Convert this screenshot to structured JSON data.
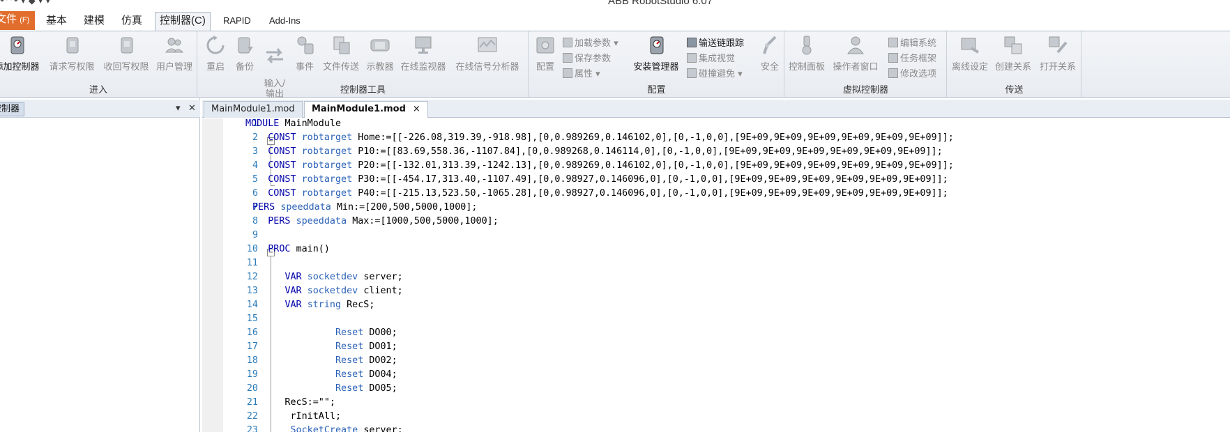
{
  "window": {
    "title": "ABB RobotStudio 6.07",
    "qat_glyphs": "↶ ↷ ▾ ◆ ▾ ▾"
  },
  "ribbon_tabs": [
    {
      "label": "文件",
      "accel": "(F)"
    },
    {
      "label": "基本"
    },
    {
      "label": "建模"
    },
    {
      "label": "仿真"
    },
    {
      "label": "控制器(C)"
    },
    {
      "label": "RAPID"
    },
    {
      "label": "Add-Ins"
    }
  ],
  "groups": {
    "enter": {
      "label": "进入",
      "buttons": [
        "添加控制器",
        "请求写权限",
        "收回写权限",
        "用户管理"
      ]
    },
    "tools": {
      "label": "控制器工具",
      "buttons": [
        "重启",
        "备份",
        "输入/\n输出",
        "事件",
        "文件传送",
        "示教器",
        "在线监视器",
        "在线信号分析器"
      ]
    },
    "config": {
      "label": "配置",
      "big1": "配置",
      "small": [
        "加载参数 ▾",
        "保存参数",
        "属性 ▾"
      ],
      "big2": "安装管理器",
      "small2": [
        "输送链跟踪",
        "集成视觉",
        "碰撞避免 ▾"
      ],
      "big3": "安全"
    },
    "virtual": {
      "label": "虚拟控制器",
      "buttons": [
        "控制面板",
        "操作者窗口"
      ],
      "small": [
        "编辑系统",
        "任务框架",
        "修改选项"
      ]
    },
    "transfer": {
      "label": "传送",
      "buttons": [
        "离线设定",
        "创建关系",
        "打开关系"
      ]
    }
  },
  "left_panel": {
    "tab_label": "控制器",
    "pin": "▾",
    "close": "✕"
  },
  "doc_tabs": [
    {
      "label": "MainModule1.mod"
    },
    {
      "label": "MainModule1.mod",
      "close": "×"
    }
  ],
  "code_lines": [
    {
      "n": "1",
      "parts": [
        [
          "kw",
          "MODULE"
        ],
        [
          "",
          "MainModule"
        ]
      ]
    },
    {
      "n": "2",
      "parts": [
        [
          "",
          "    "
        ],
        [
          "kw",
          "CONST"
        ],
        [
          "",
          ""
        ],
        [
          "ty",
          "robtarget"
        ],
        [
          "",
          "Home:=[[-226.08,319.39,-918.98],[0,0.989269,0.146102,0],[0,-1,0,0],[9E+09,9E+09,9E+09,9E+09,9E+09,9E+09]];"
        ]
      ]
    },
    {
      "n": "3",
      "parts": [
        [
          "",
          "    "
        ],
        [
          "kw",
          "CONST"
        ],
        [
          "",
          ""
        ],
        [
          "ty",
          "robtarget"
        ],
        [
          "",
          "P10:=[[83.69,558.36,-1107.84],[0,0.989268,0.146114,0],[0,-1,0,0],[9E+09,9E+09,9E+09,9E+09,9E+09,9E+09]];"
        ]
      ]
    },
    {
      "n": "4",
      "parts": [
        [
          "",
          "    "
        ],
        [
          "kw",
          "CONST"
        ],
        [
          "",
          ""
        ],
        [
          "ty",
          "robtarget"
        ],
        [
          "",
          "P20:=[[-132.01,313.39,-1242.13],[0,0.989269,0.146102,0],[0,-1,0,0],[9E+09,9E+09,9E+09,9E+09,9E+09,9E+09]];"
        ]
      ]
    },
    {
      "n": "5",
      "parts": [
        [
          "",
          "    "
        ],
        [
          "kw",
          "CONST"
        ],
        [
          "",
          ""
        ],
        [
          "ty",
          "robtarget"
        ],
        [
          "",
          "P30:=[[-454.17,313.40,-1107.49],[0,0.98927,0.146096,0],[0,-1,0,0],[9E+09,9E+09,9E+09,9E+09,9E+09,9E+09]];"
        ]
      ]
    },
    {
      "n": "6",
      "parts": [
        [
          "",
          "    "
        ],
        [
          "kw",
          "CONST"
        ],
        [
          "",
          ""
        ],
        [
          "ty",
          "robtarget"
        ],
        [
          "",
          "P40:=[[-215.13,523.50,-1065.28],[0,0.98927,0.146096,0],[0,-1,0,0],[9E+09,9E+09,9E+09,9E+09,9E+09,9E+09]];"
        ]
      ]
    },
    {
      "n": "7",
      "parts": [
        [
          "kw",
          "PERS"
        ],
        [
          "",
          ""
        ],
        [
          "ty",
          "speeddata"
        ],
        [
          "",
          "Min:=[200,500,5000,1000];"
        ]
      ]
    },
    {
      "n": "8",
      "parts": [
        [
          "",
          "    "
        ],
        [
          "kw",
          "PERS"
        ],
        [
          "",
          ""
        ],
        [
          "ty",
          "speeddata"
        ],
        [
          "",
          "Max:=[1000,500,5000,1000];"
        ]
      ]
    },
    {
      "n": "9",
      "parts": []
    },
    {
      "n": "10",
      "parts": [
        [
          "",
          "    "
        ],
        [
          "kw",
          "PROC"
        ],
        [
          "",
          "main()"
        ]
      ]
    },
    {
      "n": "11",
      "parts": []
    },
    {
      "n": "12",
      "parts": [
        [
          "",
          "       "
        ],
        [
          "kw",
          "VAR"
        ],
        [
          "",
          ""
        ],
        [
          "ty",
          "socketdev"
        ],
        [
          "",
          "server;"
        ]
      ]
    },
    {
      "n": "13",
      "parts": [
        [
          "",
          "       "
        ],
        [
          "kw",
          "VAR"
        ],
        [
          "",
          ""
        ],
        [
          "ty",
          "socketdev"
        ],
        [
          "",
          "client;"
        ]
      ]
    },
    {
      "n": "14",
      "parts": [
        [
          "",
          "       "
        ],
        [
          "kw",
          "VAR"
        ],
        [
          "",
          ""
        ],
        [
          "ty",
          "string"
        ],
        [
          "",
          "RecS;"
        ]
      ]
    },
    {
      "n": "15",
      "parts": []
    },
    {
      "n": "16",
      "parts": [
        [
          "",
          "                "
        ],
        [
          "fn",
          "Reset"
        ],
        [
          "",
          "DO00;"
        ]
      ]
    },
    {
      "n": "17",
      "parts": [
        [
          "",
          "                "
        ],
        [
          "fn",
          "Reset"
        ],
        [
          "",
          "DO01;"
        ]
      ]
    },
    {
      "n": "18",
      "parts": [
        [
          "",
          "                "
        ],
        [
          "fn",
          "Reset"
        ],
        [
          "",
          "DO02;"
        ]
      ]
    },
    {
      "n": "19",
      "parts": [
        [
          "",
          "                "
        ],
        [
          "fn",
          "Reset"
        ],
        [
          "",
          "DO04;"
        ]
      ]
    },
    {
      "n": "20",
      "parts": [
        [
          "",
          "                "
        ],
        [
          "fn",
          "Reset"
        ],
        [
          "",
          "DO05;"
        ]
      ]
    },
    {
      "n": "21",
      "parts": [
        [
          "",
          "       RecS:=\"\";"
        ]
      ]
    },
    {
      "n": "22",
      "parts": [
        [
          "",
          "        rInitAll;"
        ]
      ]
    },
    {
      "n": "23",
      "parts": [
        [
          "",
          "        "
        ],
        [
          "fn",
          "SocketCreate"
        ],
        [
          "",
          "server;"
        ]
      ]
    }
  ]
}
